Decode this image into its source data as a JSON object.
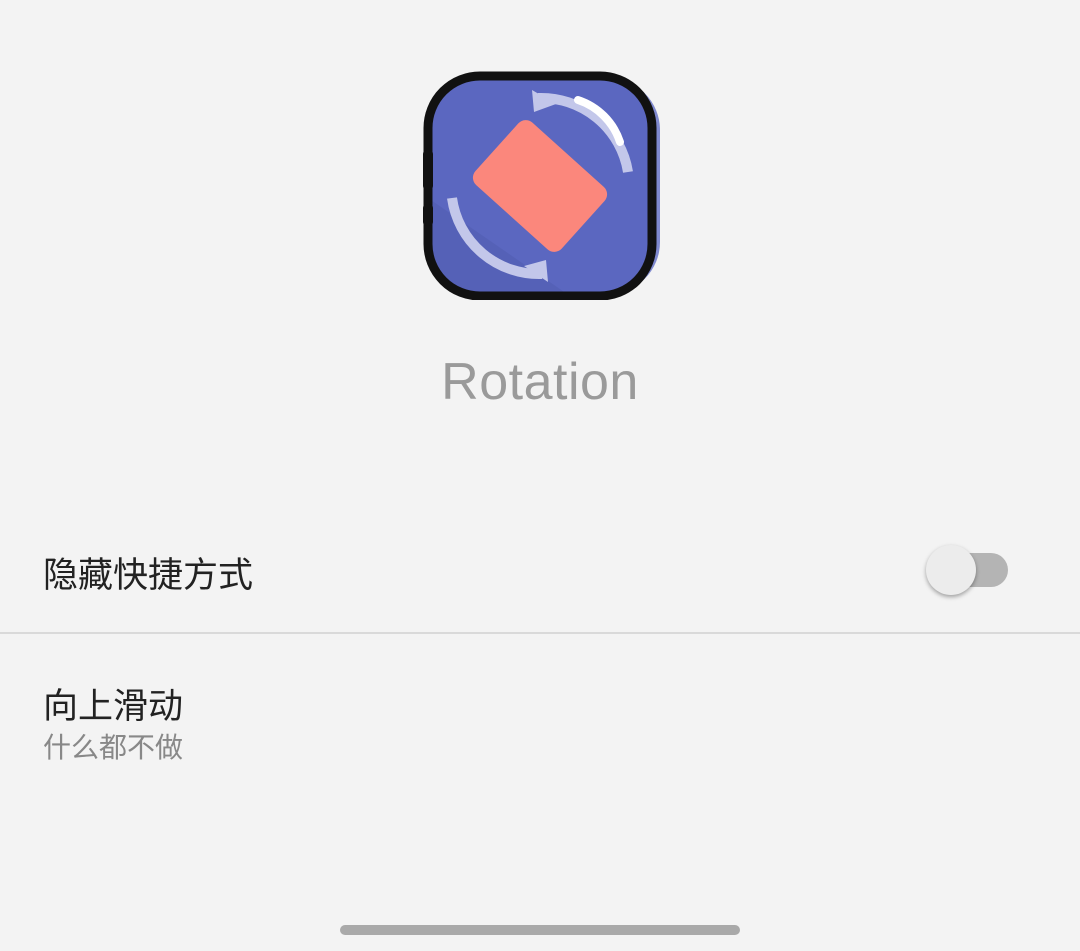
{
  "app": {
    "name": "Rotation",
    "icon": "screen-rotation-icon"
  },
  "settings": {
    "hide_shortcut": {
      "label": "隐藏快捷方式",
      "enabled": false
    },
    "swipe_up": {
      "label": "向上滑动",
      "value": "什么都不做"
    }
  },
  "colors": {
    "background": "#f3f3f3",
    "icon_fill": "#5b67c0",
    "icon_phone": "#fb877c",
    "icon_outline": "#111111",
    "toggle_track": "#b4b4b4",
    "toggle_thumb": "#ececec"
  }
}
